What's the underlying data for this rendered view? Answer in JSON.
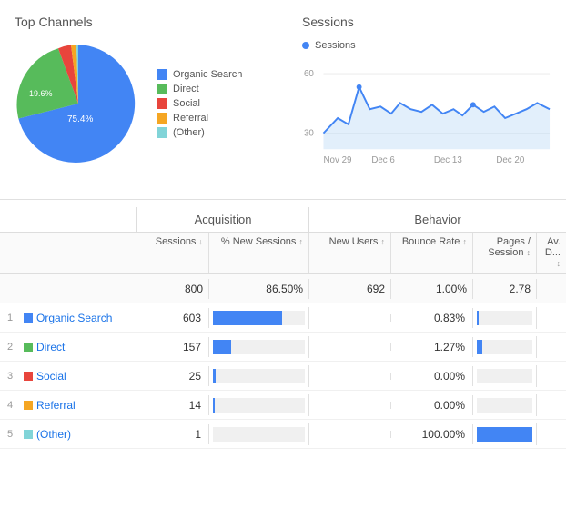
{
  "top_channels": {
    "title": "Top Channels",
    "legend": [
      {
        "label": "Organic Search",
        "color": "#4285f4"
      },
      {
        "label": "Direct",
        "color": "#57bb5b"
      },
      {
        "label": "Social",
        "color": "#e8453c"
      },
      {
        "label": "Referral",
        "color": "#f5a623"
      },
      {
        "label": "(Other)",
        "color": "#81d4d8"
      }
    ],
    "pie_label_outer": "19.6%",
    "pie_label_inner": "75.4%"
  },
  "sessions_chart": {
    "title": "Sessions",
    "legend_label": "Sessions",
    "y_axis": {
      "min": 30,
      "max": 60
    },
    "x_axis": [
      "Nov 29",
      "Dec 6",
      "Dec 13",
      "Dec 20"
    ]
  },
  "table": {
    "acquisition_label": "Acquisition",
    "behavior_label": "Behavior",
    "col_headers": {
      "channel": "",
      "sessions": "Sessions",
      "new_sessions": "% New Sessions",
      "new_users": "New Users",
      "bounce_rate": "Bounce Rate",
      "pages_session": "Pages / Session",
      "avg_duration": "Av. D..."
    },
    "total_row": {
      "sessions": "800",
      "new_sessions_pct": "86.50%",
      "new_users": "692",
      "bounce_rate": "1.00%",
      "pages_session": "2.78"
    },
    "rows": [
      {
        "num": "1",
        "color": "#4285f4",
        "name": "Organic Search",
        "sessions": "603",
        "new_sessions_pct": 75,
        "bounce_rate": "0.83%",
        "pages_bar_pct": 3
      },
      {
        "num": "2",
        "color": "#57bb5b",
        "name": "Direct",
        "sessions": "157",
        "new_sessions_pct": 20,
        "bounce_rate": "1.27%",
        "pages_bar_pct": 10
      },
      {
        "num": "3",
        "color": "#e8453c",
        "name": "Social",
        "sessions": "25",
        "new_sessions_pct": 3,
        "bounce_rate": "0.00%",
        "pages_bar_pct": 0
      },
      {
        "num": "4",
        "color": "#f5a623",
        "name": "Referral",
        "sessions": "14",
        "new_sessions_pct": 2,
        "bounce_rate": "0.00%",
        "pages_bar_pct": 0
      },
      {
        "num": "5",
        "color": "#81d4d8",
        "name": "(Other)",
        "sessions": "1",
        "new_sessions_pct": 0,
        "bounce_rate": "100.00%",
        "pages_bar_pct": 100
      }
    ]
  }
}
